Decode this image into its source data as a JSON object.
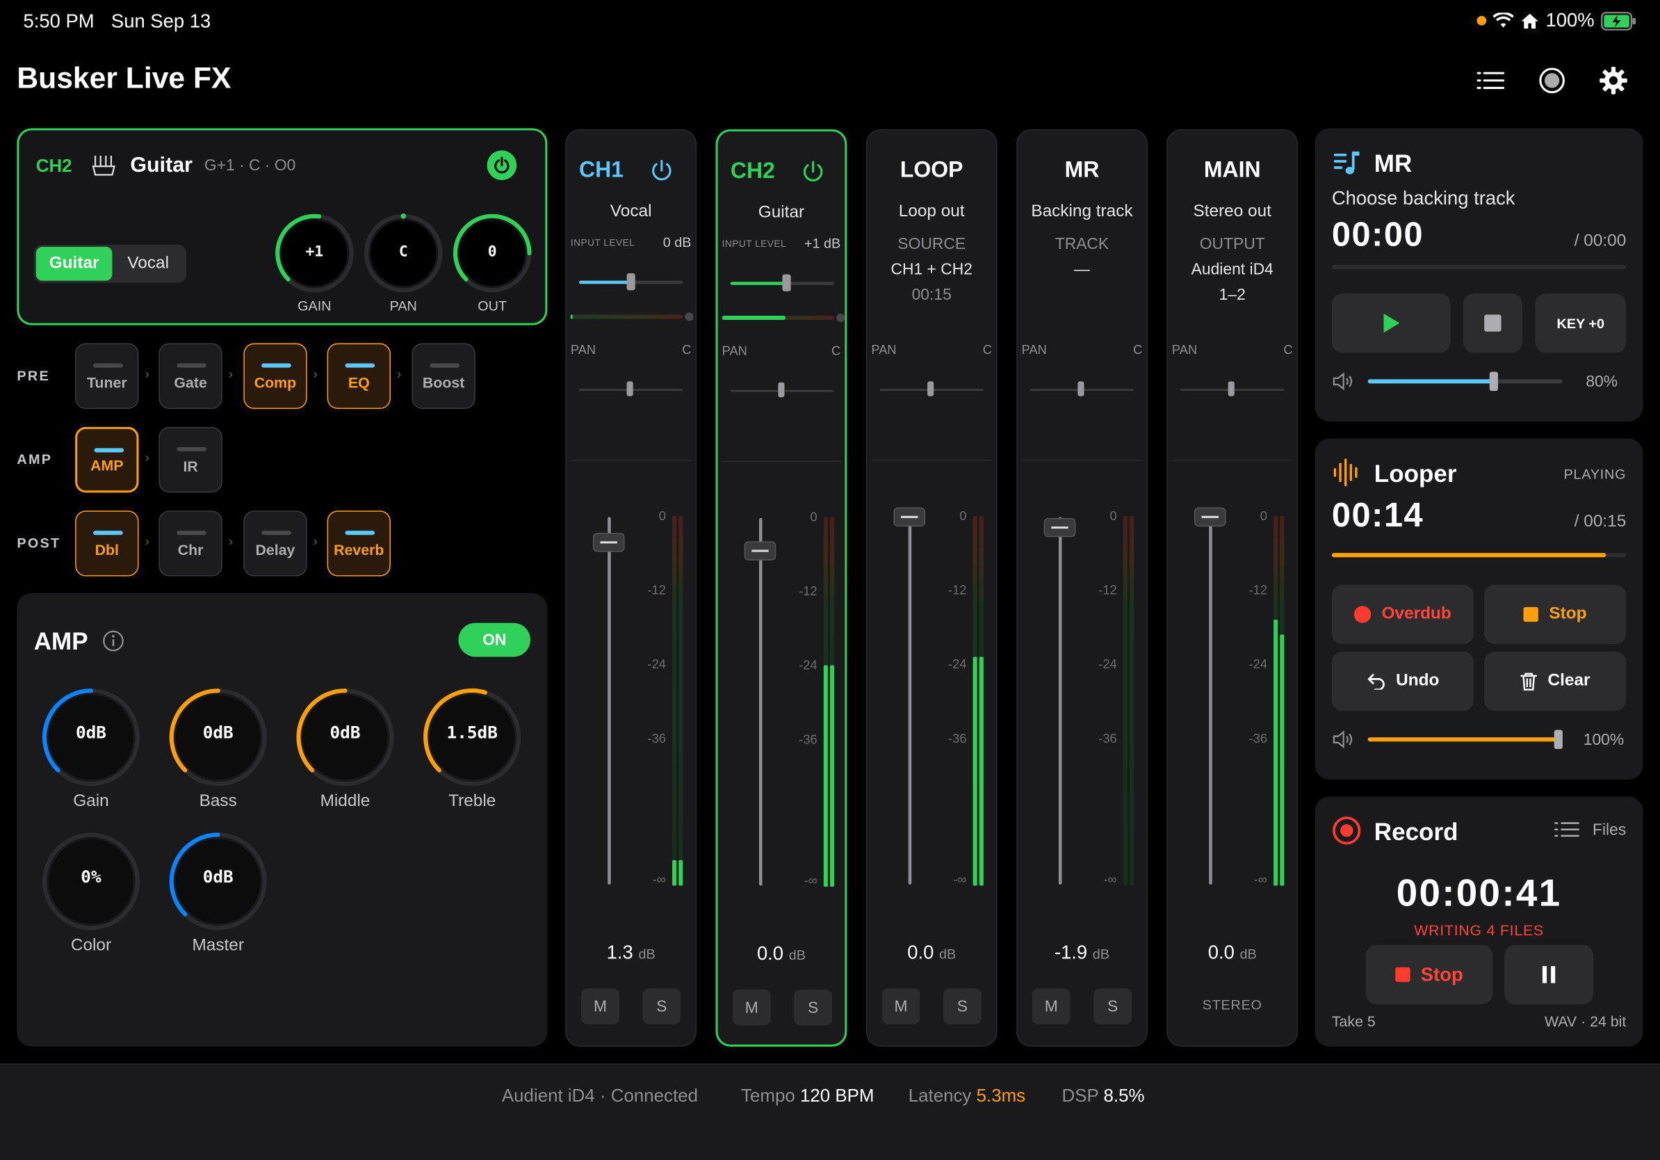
{
  "status_bar": {
    "time": "5:50 PM",
    "date": "Sun Sep 13",
    "battery": "100%"
  },
  "app": {
    "title": "Busker Live FX"
  },
  "channel_card": {
    "channel": "CH2",
    "instrument": "Guitar",
    "settings": "G+1 · C · O0",
    "mode_options": [
      "Guitar",
      "Vocal"
    ],
    "selected_mode": "Guitar",
    "knobs": [
      {
        "value": "+1",
        "label": "GAIN"
      },
      {
        "value": "C",
        "label": "PAN"
      },
      {
        "value": "0",
        "label": "OUT"
      }
    ]
  },
  "fx_chain": {
    "pre_label": "PRE",
    "amp_label": "AMP",
    "post_label": "POST",
    "pre": [
      {
        "name": "Tuner",
        "active": false
      },
      {
        "name": "Gate",
        "active": false
      },
      {
        "name": "Comp",
        "active": true
      },
      {
        "name": "EQ",
        "active": true
      },
      {
        "name": "Boost",
        "active": false
      }
    ],
    "amp": [
      {
        "name": "AMP",
        "active": true
      },
      {
        "name": "IR",
        "active": false
      }
    ],
    "post": [
      {
        "name": "Dbl",
        "active": true
      },
      {
        "name": "Chr",
        "active": false
      },
      {
        "name": "Delay",
        "active": false
      },
      {
        "name": "Reverb",
        "active": true
      }
    ]
  },
  "amp_panel": {
    "title": "AMP",
    "toggle": "ON",
    "knobs": [
      {
        "value": "0dB",
        "label": "Gain",
        "level": 0.5,
        "color": "#0a84ff"
      },
      {
        "value": "0dB",
        "label": "Bass",
        "level": 0.5,
        "color": "#ff9f0a"
      },
      {
        "value": "0dB",
        "label": "Middle",
        "level": 0.5,
        "color": "#ff9f0a"
      },
      {
        "value": "1.5dB",
        "label": "Treble",
        "level": 0.56,
        "color": "#ff9f0a"
      },
      {
        "value": "0%",
        "label": "Color",
        "level": 0,
        "color": "#0a84ff"
      },
      {
        "value": "0dB",
        "label": "Master",
        "level": 0.5,
        "color": "#0a84ff"
      }
    ]
  },
  "mixer": {
    "pan_label": "PAN",
    "pan_value": "C",
    "input_level_label": "INPUT LEVEL",
    "scale": [
      "0",
      "-12",
      "-24",
      "-36",
      "-∞"
    ],
    "db_unit": "dB",
    "mute_label": "M",
    "solo_label": "S",
    "strips": [
      {
        "id": "CH1",
        "name": "Vocal",
        "input_level": "0 dB",
        "input_fraction": 0.5,
        "fader_db": "1.3",
        "fader_pos": 0.93,
        "meter_a": 0.07,
        "meter_b": 0.07,
        "color": "#5ac8fa"
      },
      {
        "id": "CH2",
        "name": "Guitar",
        "input_level": "+1 dB",
        "input_fraction": 0.54,
        "fader_db": "0.0",
        "fader_pos": 0.91,
        "meter_a": 0.6,
        "meter_b": 0.6,
        "color": "#30d158"
      },
      {
        "id": "LOOP",
        "name": "Loop out",
        "info_label": "SOURCE",
        "info_value": "CH1 + CH2",
        "info_value2": "00:15",
        "fader_db": "0.0",
        "fader_pos": 1.0,
        "meter_a": 0.62,
        "meter_b": 0.62,
        "color": "#ffffff"
      },
      {
        "id": "MR",
        "name": "Backing track",
        "info_label": "TRACK",
        "info_value": "—",
        "fader_db": "-1.9",
        "fader_pos": 0.97,
        "meter_a": 0,
        "meter_b": 0,
        "color": "#ffffff"
      },
      {
        "id": "MAIN",
        "name": "Stereo out",
        "info_label": "OUTPUT",
        "info_value": "Audient iD4",
        "info_value2": "1–2",
        "fader_db": "0.0",
        "fader_pos": 1.0,
        "meter_a": 0.72,
        "meter_b": 0.68,
        "bottom_label": "STEREO",
        "color": "#ffffff"
      }
    ]
  },
  "mr_panel": {
    "title": "MR",
    "subtitle": "Choose backing track",
    "time": "00:00",
    "duration": "/ 00:00",
    "key_label": "KEY +0",
    "volume": "80%",
    "volume_level": 0.8
  },
  "looper_panel": {
    "title": "Looper",
    "state": "PLAYING",
    "time": "00:14",
    "duration": "/ 00:15",
    "progress": 0.93,
    "overdub_label": "Overdub",
    "stop_label": "Stop",
    "undo_label": "Undo",
    "clear_label": "Clear",
    "volume": "100%",
    "volume_level": 1.0
  },
  "record_panel": {
    "title": "Record",
    "files_label": "Files",
    "time": "00:00:41",
    "status": "WRITING 4 FILES",
    "stop_label": "Stop",
    "take": "Take 5",
    "format": "WAV · 24 bit"
  },
  "footer": {
    "device": "Audient iD4 · Connected",
    "tempo_label": "Tempo",
    "tempo_value": "120 BPM",
    "latency_label": "Latency",
    "latency_value": "5.3ms",
    "dsp_label": "DSP",
    "dsp_value": "8.5%"
  },
  "colors": {
    "accent_green": "#30d158",
    "accent_orange": "#ff9f0a",
    "accent_blue": "#0a84ff",
    "accent_cyan": "#5ac8fa",
    "record_red": "#ff3b30"
  }
}
